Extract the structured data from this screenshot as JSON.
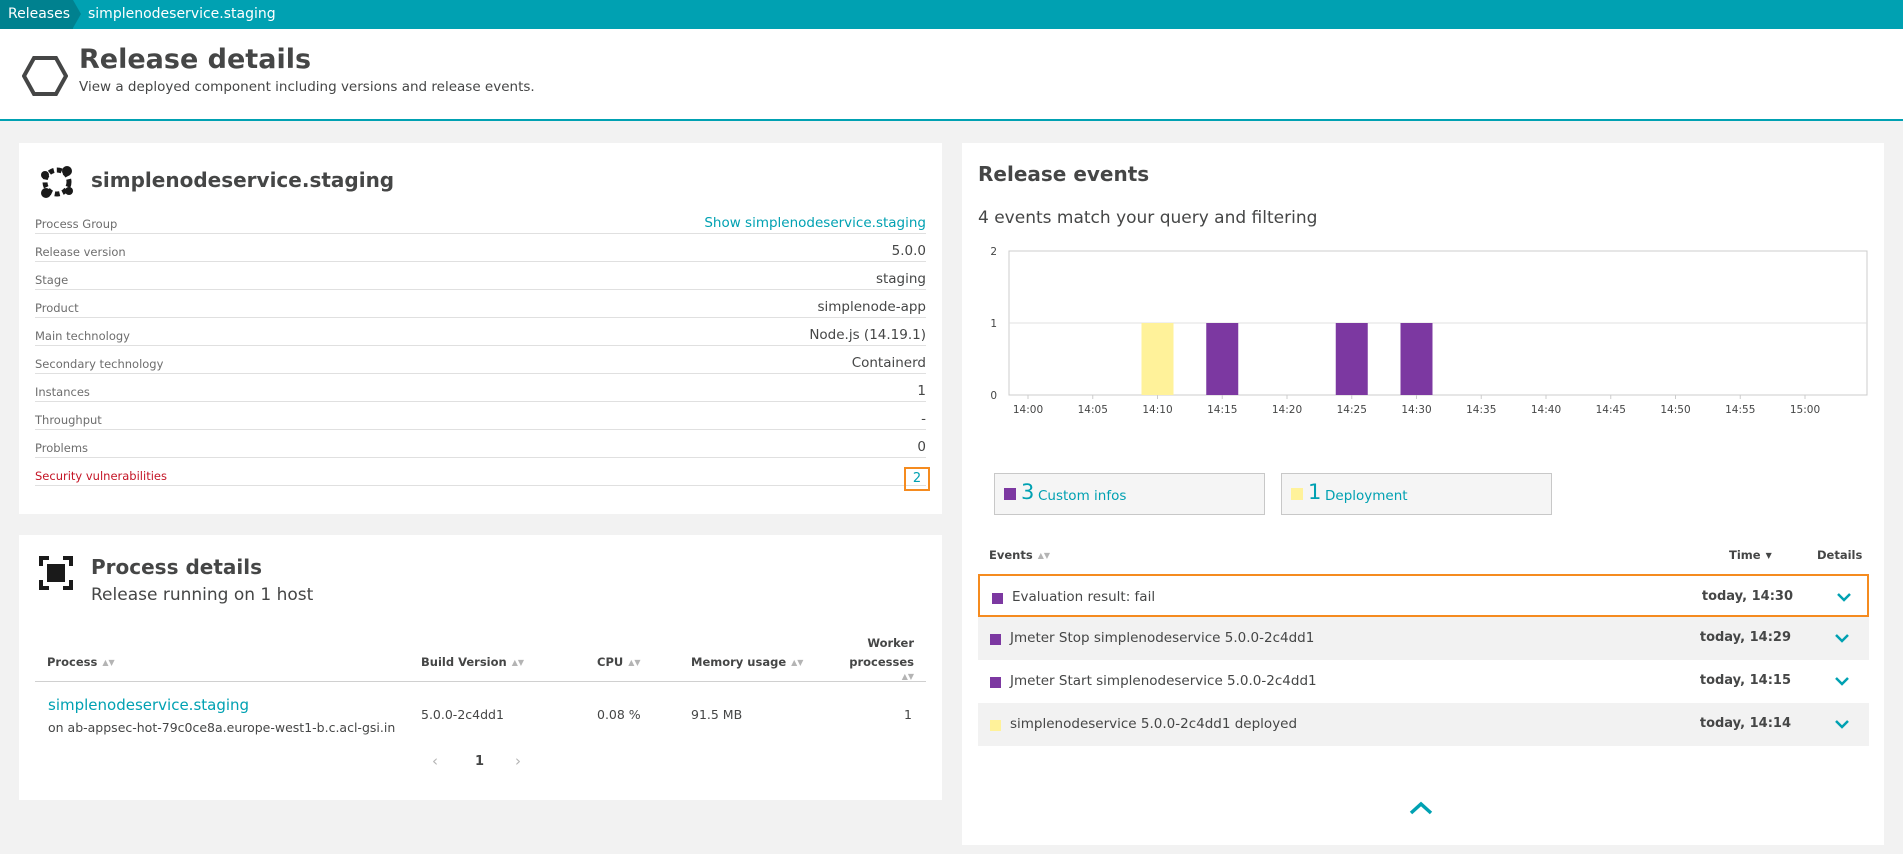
{
  "breadcrumb": {
    "first": "Releases",
    "second": "simplenodeservice.staging"
  },
  "header": {
    "title": "Release details",
    "subtitle": "View a deployed component including versions and release events."
  },
  "service": {
    "title": "simplenodeservice.staging",
    "properties": [
      {
        "label": "Process Group",
        "value": "Show simplenodeservice.staging"
      },
      {
        "label": "Release version",
        "value": "5.0.0"
      },
      {
        "label": "Stage",
        "value": "staging"
      },
      {
        "label": "Product",
        "value": "simplenode-app"
      },
      {
        "label": "Main technology",
        "value": "Node.js (14.19.1)"
      },
      {
        "label": "Secondary technology",
        "value": "Containerd"
      },
      {
        "label": "Instances",
        "value": "1"
      },
      {
        "label": "Throughput",
        "value": "-"
      },
      {
        "label": "Problems",
        "value": "0"
      },
      {
        "label": "Security vulnerabilities",
        "value": "2"
      }
    ]
  },
  "process_details": {
    "title": "Process details",
    "subtitle": "Release running on 1 host",
    "columns": [
      "Process",
      "Build Version",
      "CPU",
      "Memory usage",
      "Worker",
      "processes"
    ],
    "row": {
      "process": "simplenodeservice.staging",
      "host": "on ab-appsec-hot-79c0ce8a.europe-west1-b.c.acl-gsi.in",
      "build_version": "5.0.0-2c4dd1",
      "cpu": "0.08 %",
      "memory": "91.5 MB",
      "workers": "1"
    },
    "pager": {
      "prev": "‹",
      "page": "1",
      "next": "›"
    }
  },
  "release_events": {
    "title": "Release events",
    "match_text": "4 events match your query and filtering",
    "legend": [
      {
        "count": "3",
        "label": "Custom infos",
        "color": "#7c38a1"
      },
      {
        "count": "1",
        "label": "Deployment",
        "color": "#fff29a"
      }
    ],
    "columns": {
      "events": "Events",
      "time": "Time",
      "details": "Details"
    },
    "events": [
      {
        "text": "Evaluation result: fail",
        "time": "today, 14:30",
        "color": "#7c38a1"
      },
      {
        "text": "Jmeter Stop simplenodeservice 5.0.0-2c4dd1",
        "time": "today, 14:29",
        "color": "#7c38a1"
      },
      {
        "text": "Jmeter Start simplenodeservice 5.0.0-2c4dd1",
        "time": "today, 14:15",
        "color": "#7c38a1"
      },
      {
        "text": "simplenodeservice 5.0.0-2c4dd1 deployed",
        "time": "today, 14:14",
        "color": "#fff29a"
      }
    ]
  },
  "chart_data": {
    "type": "bar",
    "categories": [
      "14:00",
      "14:05",
      "14:10",
      "14:15",
      "14:20",
      "14:25",
      "14:30",
      "14:35",
      "14:40",
      "14:45",
      "14:50",
      "14:55",
      "15:00"
    ],
    "y_ticks": [
      "0",
      "1",
      "2"
    ],
    "ylim": [
      0,
      2
    ],
    "grid": true,
    "bars": [
      {
        "x": "14:10",
        "value": 1,
        "series": "Deployment",
        "color": "#fff29a"
      },
      {
        "x": "14:15",
        "value": 1,
        "series": "Custom infos",
        "color": "#7c38a1"
      },
      {
        "x": "14:25",
        "value": 1,
        "series": "Custom infos",
        "color": "#7c38a1"
      },
      {
        "x": "14:30",
        "value": 1,
        "series": "Custom infos",
        "color": "#7c38a1"
      }
    ]
  },
  "colors": {
    "accent": "#00a1b2",
    "alert": "#c41425",
    "highlight": "#f58b1f"
  }
}
